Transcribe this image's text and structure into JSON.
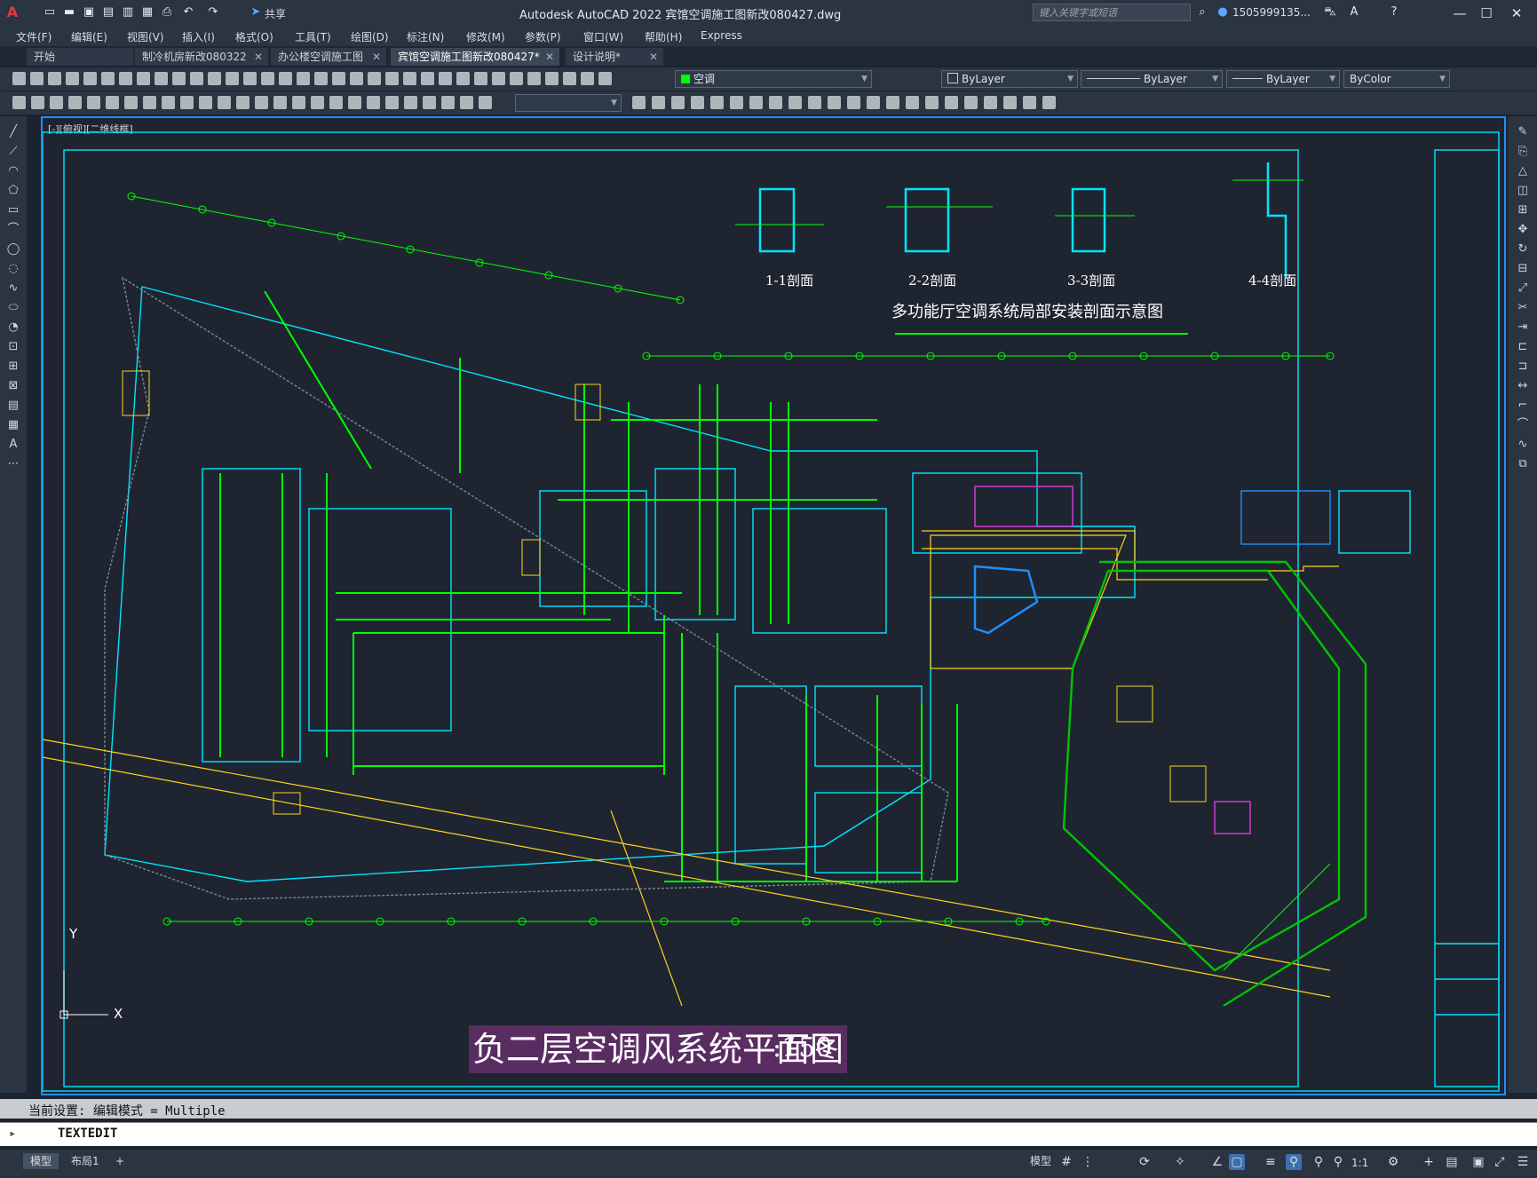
{
  "titlebar": {
    "app_title": "Autodesk AutoCAD 2022    宾馆空调施工图新改080427.dwg",
    "share_label": "共享",
    "search_placeholder": "键入关键字或短语",
    "user": "1505999135...",
    "min": "—",
    "max": "☐",
    "close": "✕"
  },
  "menu": [
    "文件(F)",
    "编辑(E)",
    "视图(V)",
    "插入(I)",
    "格式(O)",
    "工具(T)",
    "绘图(D)",
    "标注(N)",
    "修改(M)",
    "参数(P)",
    "窗口(W)",
    "帮助(H)",
    "Express"
  ],
  "tabs": [
    {
      "label": "开始"
    },
    {
      "label": "制冷机房新改080322"
    },
    {
      "label": "办公楼空调施工图"
    },
    {
      "label": "宾馆空调施工图新改080427*"
    },
    {
      "label": "设计说明*"
    }
  ],
  "toolbar": {
    "layer_combo": "空调",
    "color_combo": "ByLayer",
    "linetype_combo": "ByLayer",
    "lineweight_combo": "ByLayer",
    "plotstyle_combo": "ByColor"
  },
  "canvas": {
    "viewport_label": "[-][俯视][二维线框]",
    "drawing_title": "负二层空调风系统平面图",
    "scale_text": ":150",
    "section_title": "多功能厅空调系统局部安装剖面示意图",
    "sections": [
      "1-1剖面",
      "2-2剖面",
      "3-3剖面",
      "4-4剖面"
    ],
    "axis_y": "Y",
    "axis_x": "X"
  },
  "command": {
    "history": "当前设置: 编辑模式 = Multiple",
    "current": "TEXTEDIT"
  },
  "status": {
    "model_tab": "模型",
    "layout_tab": "布局1",
    "add_tab": "+",
    "model_btn": "模型",
    "scale": "1:1"
  },
  "colors": {
    "accent": "#1e8fff",
    "drawing_bg": "#1e2530",
    "duct": "#00ff00",
    "wall": "#00e5ff",
    "title_bg": "#5a2d62"
  }
}
